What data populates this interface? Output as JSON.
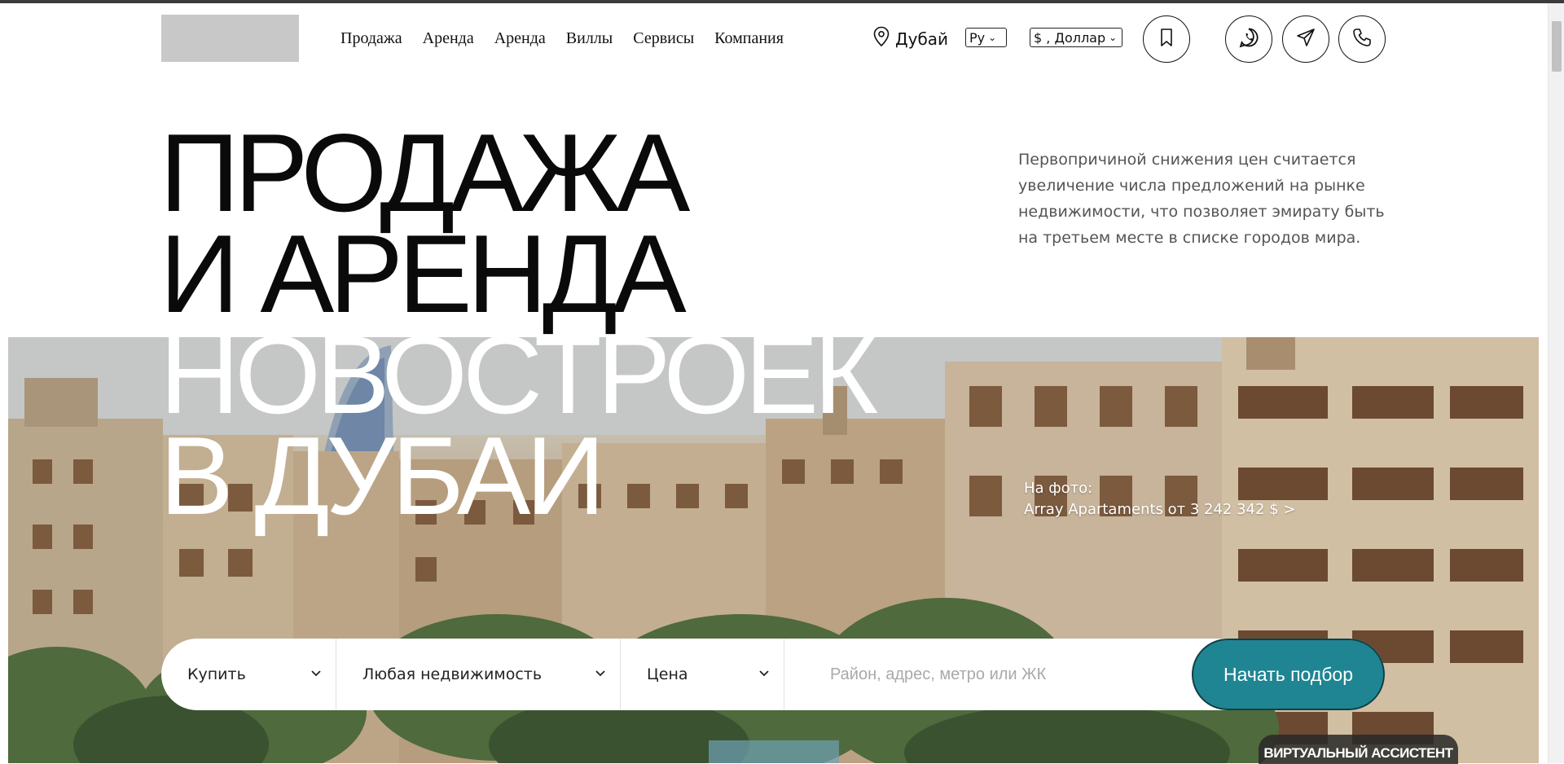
{
  "header": {
    "nav": [
      "Продажа",
      "Аренда",
      "Аренда",
      "Виллы",
      "Сервисы",
      "Компания"
    ],
    "location": "Дубай",
    "language": "Ру",
    "currency": "$ , Доллар"
  },
  "hero": {
    "title_lines": [
      "ПРОДАЖА",
      "И АРЕНДА",
      "НОВОСТРОЕК",
      "В ДУБАИ"
    ],
    "description": "Первопричиной снижения цен считается увеличение числа предложений на рынке недвижимости, что позволяет эмирату быть на третьем месте в списке городов мира.",
    "caption_label": "На фото:",
    "caption_link": "Array Apartaments от 3 242 342 $ >"
  },
  "search": {
    "deal": "Купить",
    "property_type": "Любая недвижимость",
    "price": "Цена",
    "placeholder": "Район, адрес, метро или ЖК",
    "submit": "Начать подбор"
  },
  "assistant": "ВИРТУАЛЬНЫЙ АССИСТЕНТ",
  "colors": {
    "accent": "#1f8592",
    "title_dark": "#0a0a0a",
    "title_light": "#ffffff"
  }
}
